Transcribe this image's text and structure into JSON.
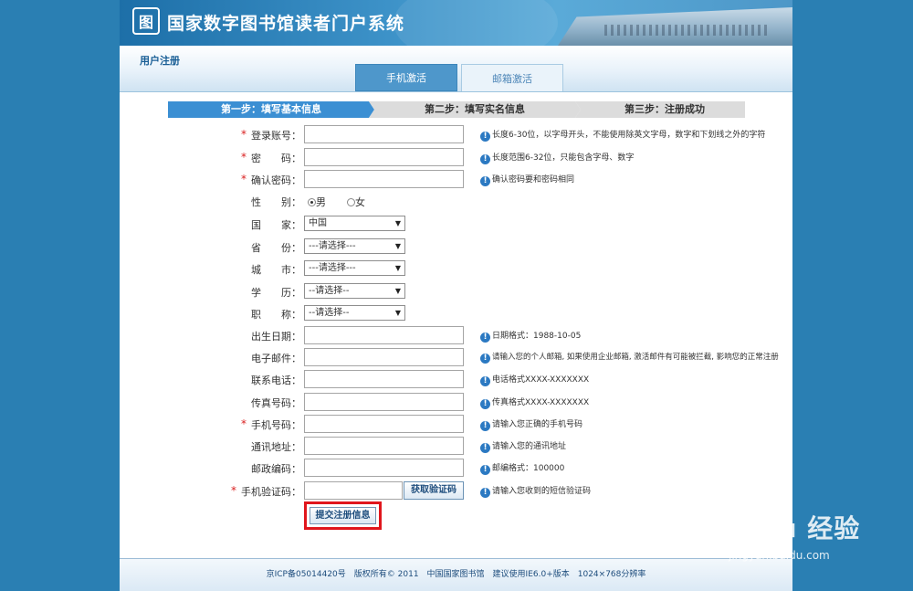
{
  "header": {
    "logo_glyph": "图",
    "site_title": "国家数字图书馆读者门户系统"
  },
  "subheader": {
    "title": "用户注册",
    "tabs": [
      {
        "label": "手机激活",
        "active": true
      },
      {
        "label": "邮箱激活",
        "active": false
      }
    ]
  },
  "steps": [
    {
      "label": "第一步：填写基本信息",
      "active": true
    },
    {
      "label": "第二步：填写实名信息",
      "active": false
    },
    {
      "label": "第三步：注册成功",
      "active": false
    }
  ],
  "form": {
    "login_account": {
      "label": "登录账号：",
      "hint": "长度6-30位，以字母开头，不能使用除英文字母，数字和下划线之外的字符",
      "value": ""
    },
    "password": {
      "label": "密　　码：",
      "hint": "长度范围6-32位，只能包含字母、数字",
      "value": ""
    },
    "confirm_password": {
      "label": "确认密码：",
      "hint": "确认密码要和密码相同",
      "value": ""
    },
    "gender": {
      "label": "性　　别：",
      "male": "男",
      "female": "女",
      "selected": "男"
    },
    "country": {
      "label": "国　　家：",
      "value": "中国"
    },
    "province": {
      "label": "省　　份：",
      "value": "---请选择---"
    },
    "city": {
      "label": "城　　市：",
      "value": "---请选择---"
    },
    "education": {
      "label": "学　　历：",
      "value": "--请选择--"
    },
    "title": {
      "label": "职　　称：",
      "value": "--请选择--"
    },
    "birth_date": {
      "label": "出生日期：",
      "hint": "日期格式：1988-10-05",
      "value": ""
    },
    "email": {
      "label": "电子邮件：",
      "hint": "请输入您的个人邮箱, 如果使用企业邮箱, 激活邮件有可能被拦截, 影响您的正常注册",
      "value": ""
    },
    "phone": {
      "label": "联系电话：",
      "hint": "电话格式XXXX-XXXXXXX",
      "value": ""
    },
    "fax": {
      "label": "传真号码：",
      "hint": "传真格式XXXX-XXXXXXX",
      "value": ""
    },
    "mobile": {
      "label": "手机号码：",
      "hint": "请输入您正确的手机号码",
      "value": ""
    },
    "address": {
      "label": "通讯地址：",
      "hint": "请输入您的通讯地址",
      "value": ""
    },
    "postcode": {
      "label": "邮政编码：",
      "hint": "邮编格式：100000",
      "value": ""
    },
    "sms_code": {
      "label": "手机验证码：",
      "hint": "请输入您收到的短信验证码",
      "value": "",
      "button": "获取验证码"
    },
    "required_mark": "*",
    "info_glyph": "!",
    "submit": "提交注册信息"
  },
  "footer": {
    "text": "京ICP备05014420号　版权所有© 2011　中国国家图书馆　建议使用IE6.0+版本　1024×768分辨率"
  },
  "watermark": {
    "main": "Bai du 经验",
    "sub": "jingyan.baidu.com"
  },
  "colors": {
    "accent": "#3b8fd3",
    "background": "#2a7fb3",
    "required": "#d91e1e",
    "highlight": "#e0161c"
  }
}
